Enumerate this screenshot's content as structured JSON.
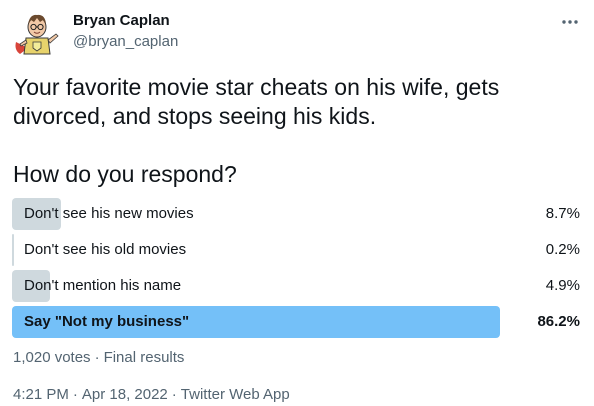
{
  "author": {
    "display_name": "Bryan Caplan",
    "handle": "@bryan_caplan",
    "avatar_icon": "cartoon-avatar-icon"
  },
  "tweet": {
    "text": "Your favorite movie star cheats on his wife, gets\ndivorced, and stops seeing his kids.\n\nHow do you respond?"
  },
  "poll": {
    "options": [
      {
        "label": "Don't see his new movies",
        "percent_label": "8.7%",
        "percent": 8.7,
        "winner": false
      },
      {
        "label": "Don't see his old movies",
        "percent_label": "0.2%",
        "percent": 0.2,
        "winner": false
      },
      {
        "label": "Don't mention his name",
        "percent_label": "4.9%",
        "percent": 4.9,
        "winner": false
      },
      {
        "label": "Say \"Not my business\"",
        "percent_label": "86.2%",
        "percent": 86.2,
        "winner": true
      }
    ],
    "votes": "1,020 votes",
    "separator": "·",
    "status": "Final results"
  },
  "meta": {
    "time": "4:21 PM",
    "date": "Apr 18, 2022",
    "separator": "·",
    "source": "Twitter Web App"
  },
  "colors": {
    "bar_default": "#cfd9de",
    "bar_winner": "#74c0f8",
    "secondary_text": "#536471"
  }
}
